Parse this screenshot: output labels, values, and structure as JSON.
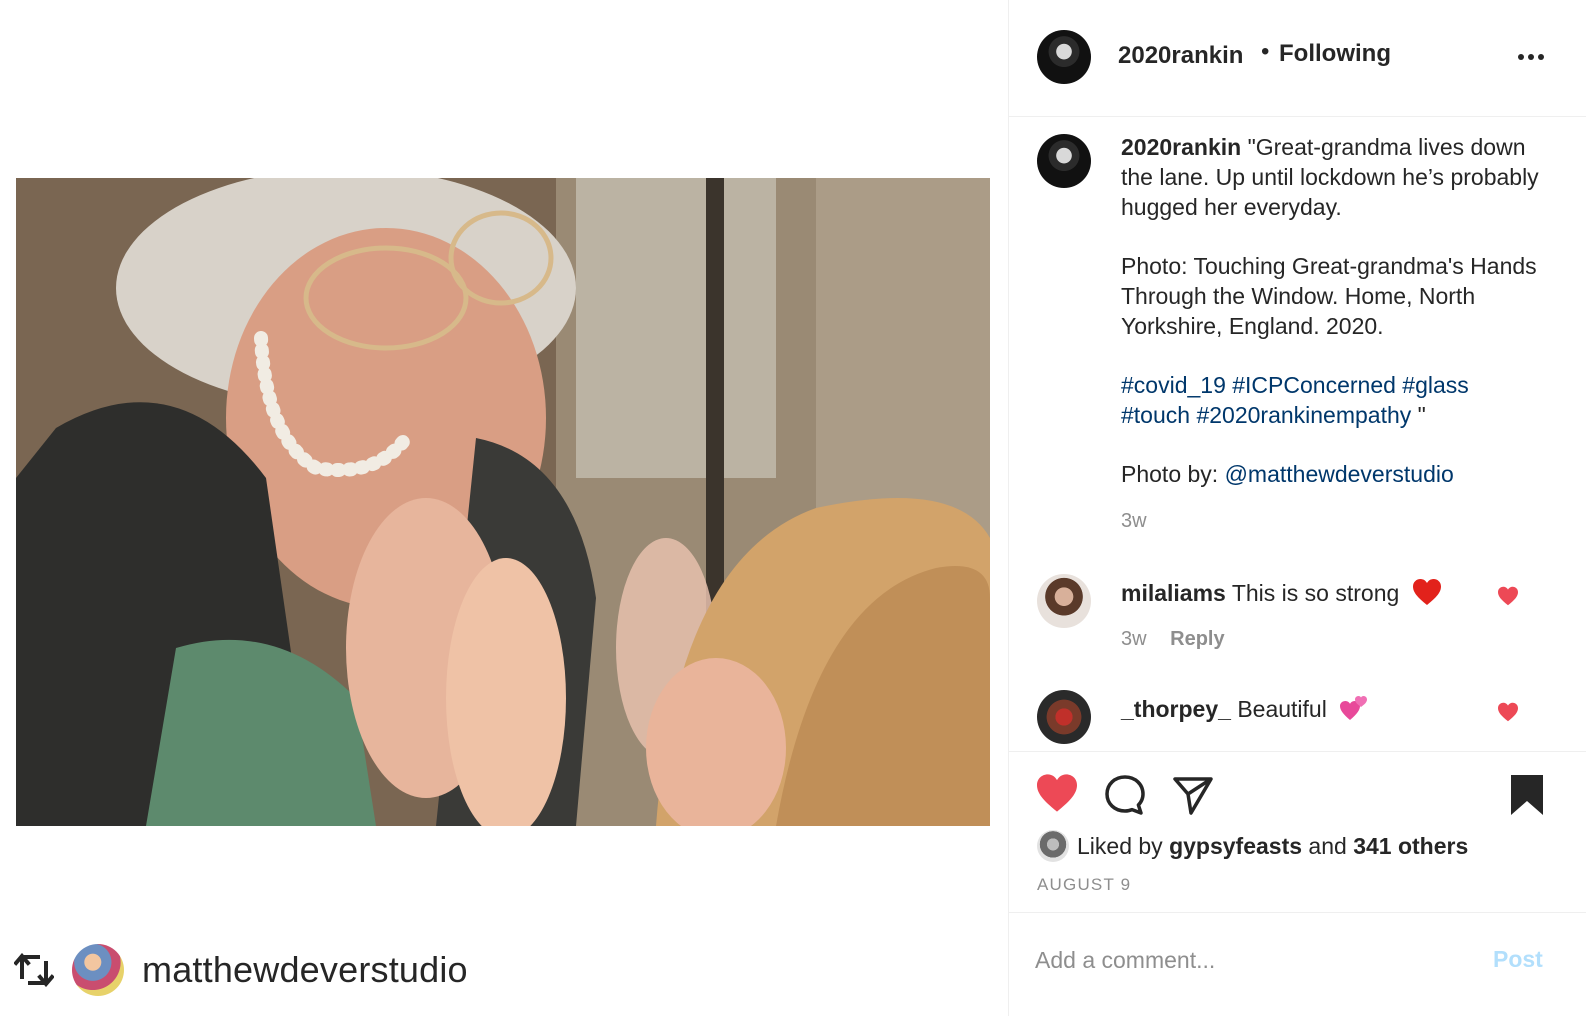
{
  "post": {
    "author": "2020rankin",
    "follow_dot": "•",
    "follow_status": "Following",
    "more_icon": "more-horizontal-icon",
    "caption": {
      "username": "2020rankin",
      "line1": "\"Great-grandma lives down the lane. Up until lockdown he’s probably hugged her everyday.",
      "line2": "Photo: Touching Great-grandma's Hands Through the Window. Home, North Yorkshire, England. 2020.",
      "hashtags_1": "#covid_19 #ICPConcerned #glass",
      "hashtags_2": "#touch #2020rankinempathy",
      "close_quote": " \"",
      "credit_prefix": "Photo by:",
      "credit_handle": "@matthewdeverstudio",
      "time": "3w"
    },
    "comments": [
      {
        "username": "milaliams",
        "text": "This is so strong",
        "emoji": "red-heart",
        "time": "3w",
        "reply_label": "Reply"
      },
      {
        "username": "_thorpey_",
        "text": "Beautiful",
        "emoji": "two-hearts"
      }
    ],
    "likes": {
      "prefix": "Liked by",
      "first_liker": "gypsyfeasts",
      "connector": "and",
      "others": "341 others"
    },
    "date": "AUGUST 9",
    "comment_input": {
      "placeholder": "Add a comment...",
      "post_label": "Post"
    },
    "repost": {
      "icon": "repost-icon",
      "handle": "matthewdeverstudio"
    }
  },
  "colors": {
    "like_red": "#ed4956",
    "link_blue": "#00376b",
    "muted": "#8e8e8e",
    "post_disabled": "#b2dffc"
  }
}
